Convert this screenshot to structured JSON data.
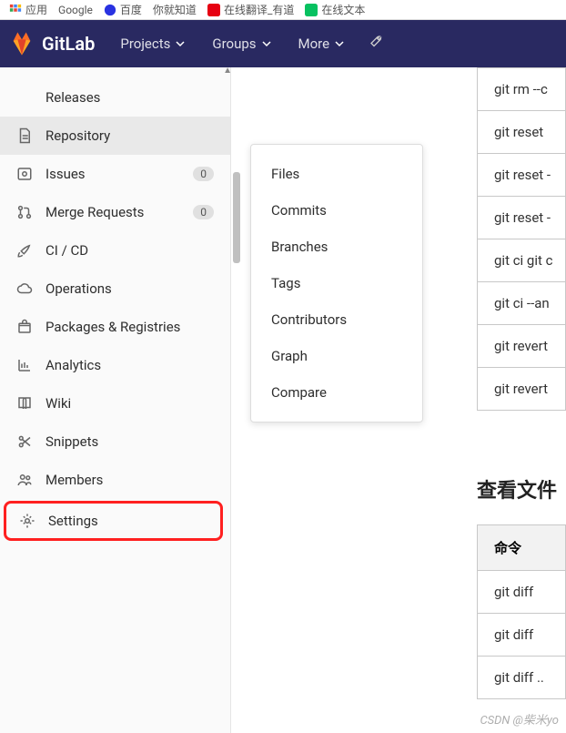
{
  "bookmarks": [
    {
      "label": "应用"
    },
    {
      "label": "Google"
    },
    {
      "label": "百度"
    },
    {
      "label": "你就知道"
    },
    {
      "label": "在线翻译_有道"
    },
    {
      "label": "在线文本"
    }
  ],
  "brand": {
    "name": "GitLab"
  },
  "nav": {
    "projects": "Projects",
    "groups": "Groups",
    "more": "More"
  },
  "sidebar": {
    "releases": "Releases",
    "repository": "Repository",
    "issues": "Issues",
    "issues_count": "0",
    "merge_requests": "Merge Requests",
    "mr_count": "0",
    "cicd": "CI / CD",
    "operations": "Operations",
    "packages": "Packages & Registries",
    "analytics": "Analytics",
    "wiki": "Wiki",
    "snippets": "Snippets",
    "members": "Members",
    "settings": "Settings"
  },
  "flyout": {
    "files": "Files",
    "commits": "Commits",
    "branches": "Branches",
    "tags": "Tags",
    "contributors": "Contributors",
    "graph": "Graph",
    "compare": "Compare"
  },
  "commands_top": [
    "git rm --c",
    "git reset",
    "git reset -",
    "git reset -",
    "git ci git c",
    "git ci --an",
    "git revert",
    "git revert"
  ],
  "section_heading": "查看文件",
  "table2_header": "命令",
  "commands_bottom": [
    "git diff",
    "git diff",
    "git diff .."
  ],
  "watermark": "CSDN @柴米yo"
}
